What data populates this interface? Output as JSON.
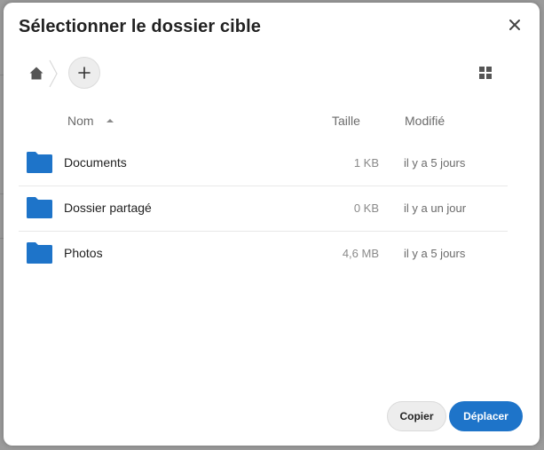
{
  "dialog": {
    "title": "Sélectionner le dossier cible",
    "close_icon": "close-icon"
  },
  "toolbar": {
    "home_icon": "home-icon",
    "new_folder_icon": "plus-icon",
    "view_toggle_icon": "grid-view-icon"
  },
  "table": {
    "columns": {
      "name": "Nom",
      "size": "Taille",
      "modified": "Modifié"
    },
    "sort": {
      "column": "name",
      "direction": "ascending"
    },
    "rows": [
      {
        "name": "Documents",
        "size": "1 KB",
        "modified": "il y a 5 jours",
        "icon": "folder-icon"
      },
      {
        "name": "Dossier partagé",
        "size": "0 KB",
        "modified": "il y a un jour",
        "icon": "folder-icon"
      },
      {
        "name": "Photos",
        "size": "4,6 MB",
        "modified": "il y a 5 jours",
        "icon": "folder-icon"
      }
    ]
  },
  "actions": {
    "copy_label": "Copier",
    "move_label": "Déplacer"
  },
  "colors": {
    "accent": "#1e74c9",
    "folder": "#1e74c9",
    "backdrop": "#9b9b9b"
  }
}
